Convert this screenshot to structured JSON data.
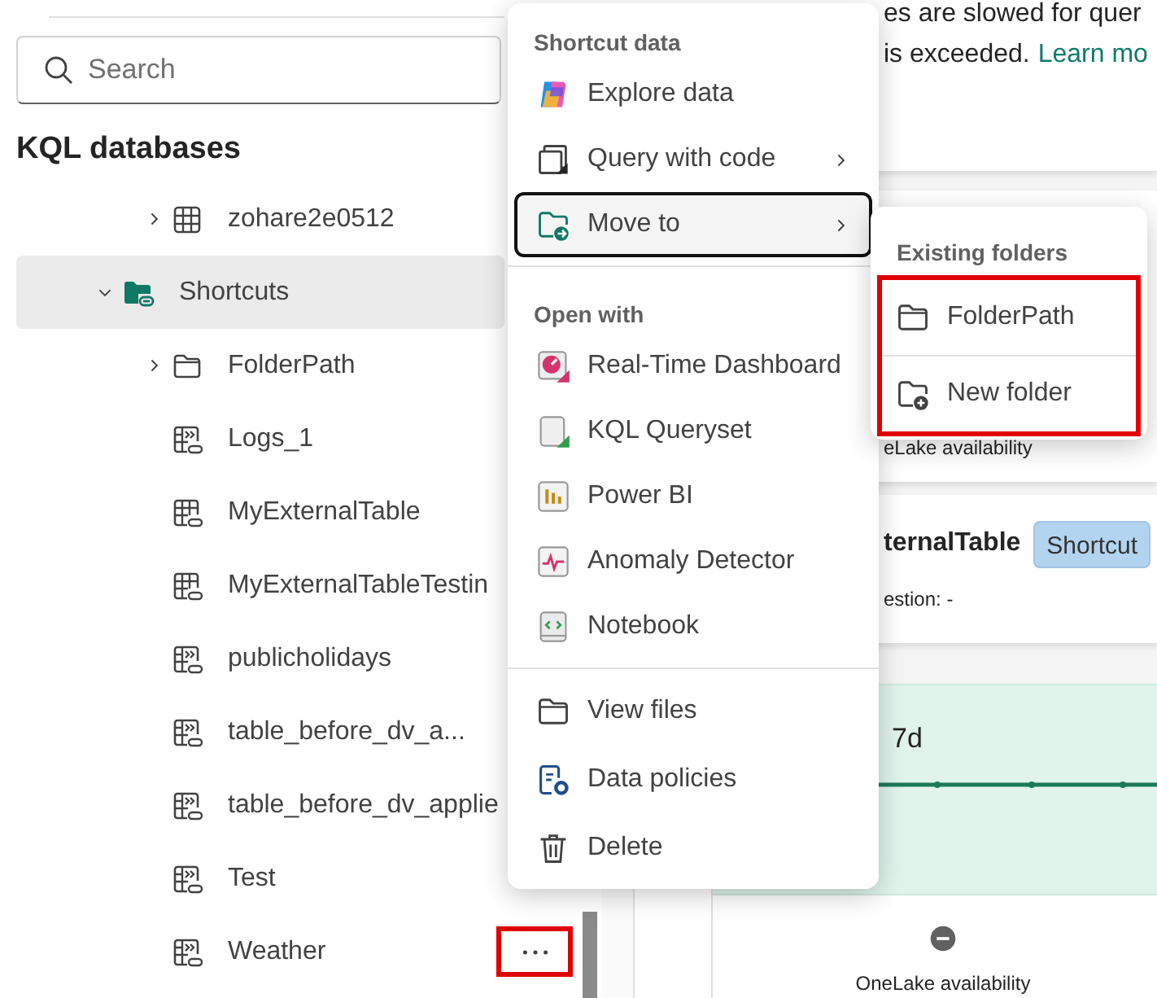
{
  "search": {
    "placeholder": "Search"
  },
  "section_title": "KQL databases",
  "tree": [
    {
      "label": "zohare2e0512",
      "kind": "table",
      "expanded": false,
      "selected": false
    },
    {
      "label": "Shortcuts",
      "kind": "group",
      "expanded": true,
      "selected": true,
      "children": [
        {
          "label": "FolderPath",
          "kind": "folder",
          "expanded": false,
          "selected": false,
          "hovered": false
        },
        {
          "label": "Logs_1",
          "kind": "stream-shortcut",
          "selected": false,
          "hovered": false
        },
        {
          "label": "MyExternalTable",
          "kind": "table-shortcut",
          "selected": false,
          "hovered": false
        },
        {
          "label": "MyExternalTableTestin",
          "kind": "table-shortcut",
          "selected": false,
          "hovered": false
        },
        {
          "label": "publicholidays",
          "kind": "stream-shortcut",
          "selected": false,
          "hovered": false
        },
        {
          "label": "table_before_dv_a...",
          "kind": "stream-shortcut",
          "selected": false,
          "hovered": false
        },
        {
          "label": "table_before_dv_applie",
          "kind": "stream-shortcut",
          "selected": false,
          "hovered": false
        },
        {
          "label": "Test",
          "kind": "stream-shortcut",
          "selected": false,
          "hovered": false
        },
        {
          "label": "Weather",
          "kind": "stream-shortcut",
          "selected": false,
          "hovered": true
        }
      ]
    }
  ],
  "background": {
    "notice_line1": "es are slowed for quer",
    "notice_line2": "is exceeded.",
    "notice_link": "Learn mo",
    "availability_top": "eLake availability",
    "table_title": "ternalTable",
    "badge": "Shortcut",
    "ingestion": "estion: -",
    "timespan": "7d",
    "availability_bottom": "OneLake availability"
  },
  "context_menu": {
    "sections": [
      {
        "heading": "Shortcut data",
        "items": [
          {
            "label": "Explore data",
            "kind": "copilot",
            "submenu": false,
            "selected": false
          },
          {
            "label": "Query with code",
            "kind": "query",
            "submenu": true,
            "selected": false
          },
          {
            "label": "Move to",
            "kind": "move",
            "submenu": true,
            "selected": true
          }
        ]
      },
      {
        "heading": "Open with",
        "items": [
          {
            "label": "Real-Time Dashboard",
            "kind": "dashboard",
            "submenu": false,
            "selected": false
          },
          {
            "label": "KQL Queryset",
            "kind": "queryset",
            "submenu": false,
            "selected": false
          },
          {
            "label": "Power BI",
            "kind": "powerbi",
            "submenu": false,
            "selected": false
          },
          {
            "label": "Anomaly Detector",
            "kind": "anomaly",
            "submenu": false,
            "selected": false
          },
          {
            "label": "Notebook",
            "kind": "notebook",
            "submenu": false,
            "selected": false
          }
        ]
      },
      {
        "items": [
          {
            "label": "View files",
            "kind": "folder",
            "submenu": false,
            "selected": false
          },
          {
            "label": "Data policies",
            "kind": "policy",
            "submenu": false,
            "selected": false
          },
          {
            "label": "Delete",
            "kind": "trash",
            "submenu": false,
            "selected": false
          }
        ]
      }
    ]
  },
  "submenu": {
    "heading": "Existing folders",
    "items": [
      {
        "label": "FolderPath",
        "kind": "folder"
      },
      {
        "label": "New folder",
        "kind": "new-folder"
      }
    ]
  }
}
